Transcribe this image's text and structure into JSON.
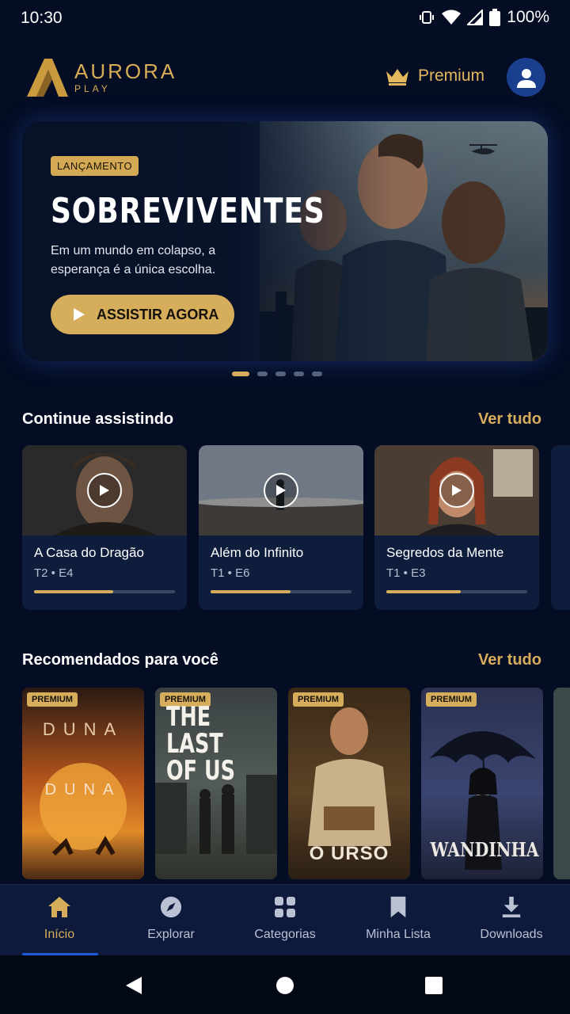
{
  "status_bar": {
    "time": "10:30",
    "battery": "100%"
  },
  "header": {
    "logo_name": "AURORA",
    "logo_sub": "PLAY",
    "premium_label": "Premium"
  },
  "hero": {
    "badge": "LANÇAMENTO",
    "title": "SOBREVIVENTES",
    "description": "Em um mundo em colapso, a esperança é a única escolha.",
    "cta": "ASSISTIR AGORA"
  },
  "carousel": {
    "count": 5,
    "active_index": 0
  },
  "continue_watching": {
    "title": "Continue assistindo",
    "see_all": "Ver tudo",
    "items": [
      {
        "title": "A Casa do Dragão",
        "episode": "T2 • E4",
        "progress": 0.56
      },
      {
        "title": "Além do Infinito",
        "episode": "T1 • E6",
        "progress": 0.57
      },
      {
        "title": "Segredos da Mente",
        "episode": "T1 • E3",
        "progress": 0.53
      }
    ]
  },
  "recommended": {
    "title": "Recomendados para você",
    "see_all": "Ver tudo",
    "items": [
      {
        "badge": "PREMIUM",
        "poster_text": "DUNA"
      },
      {
        "badge": "PREMIUM",
        "poster_text": "THE LAST OF US"
      },
      {
        "badge": "PREMIUM",
        "poster_text": "O URSO"
      },
      {
        "badge": "PREMIUM",
        "poster_text": "WANDINHA"
      }
    ]
  },
  "bottom_nav": {
    "items": [
      {
        "label": "Início",
        "icon": "home-icon",
        "active": true
      },
      {
        "label": "Explorar",
        "icon": "compass-icon",
        "active": false
      },
      {
        "label": "Categorias",
        "icon": "grid-icon",
        "active": false
      },
      {
        "label": "Minha Lista",
        "icon": "bookmark-icon",
        "active": false
      },
      {
        "label": "Downloads",
        "icon": "download-icon",
        "active": false
      }
    ]
  },
  "colors": {
    "background": "#050d24",
    "accent_gold": "#d6ae5b",
    "nav_bg": "#0d1a3c",
    "avatar_blue": "#1b3f8f"
  }
}
